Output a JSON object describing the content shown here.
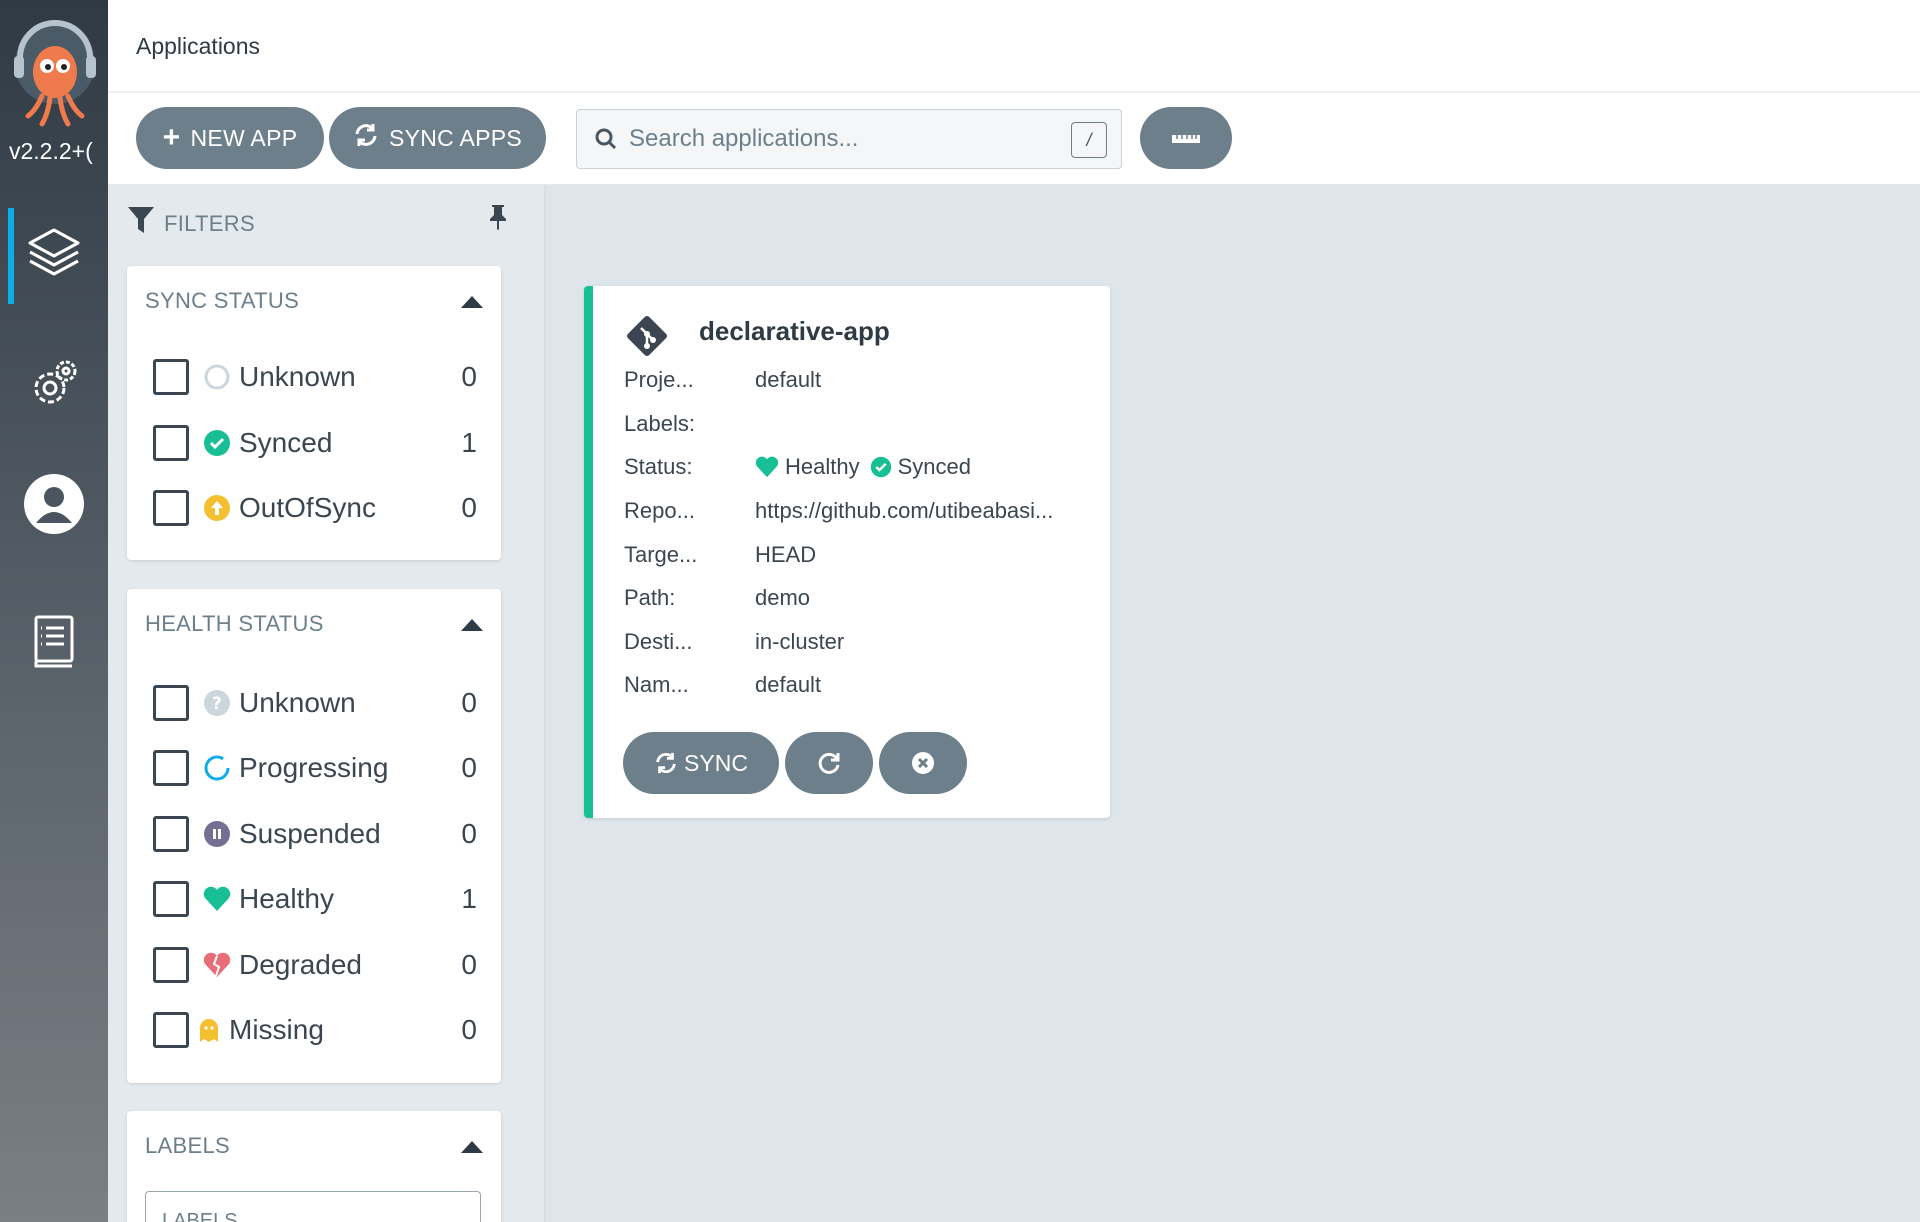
{
  "nav": {
    "version": "v2.2.2+(",
    "items": [
      {
        "name": "applications",
        "icon": "layers-icon"
      },
      {
        "name": "settings",
        "icon": "gears-icon"
      },
      {
        "name": "user-info",
        "icon": "user-icon"
      },
      {
        "name": "docs",
        "icon": "book-icon"
      }
    ]
  },
  "header": {
    "title": "Applications"
  },
  "toolbar": {
    "new_app_label": "NEW APP",
    "sync_apps_label": "SYNC APPS",
    "search_placeholder": "Search applications...",
    "search_shortcut": "/"
  },
  "filters": {
    "title": "FILTERS",
    "sync_status": {
      "title": "SYNC STATUS",
      "items": [
        {
          "label": "Unknown",
          "count": "0"
        },
        {
          "label": "Synced",
          "count": "1"
        },
        {
          "label": "OutOfSync",
          "count": "0"
        }
      ]
    },
    "health_status": {
      "title": "HEALTH STATUS",
      "items": [
        {
          "label": "Unknown",
          "count": "0"
        },
        {
          "label": "Progressing",
          "count": "0"
        },
        {
          "label": "Suspended",
          "count": "0"
        },
        {
          "label": "Healthy",
          "count": "1"
        },
        {
          "label": "Degraded",
          "count": "0"
        },
        {
          "label": "Missing",
          "count": "0"
        }
      ]
    },
    "labels": {
      "title": "LABELS",
      "placeholder": "LABELS"
    }
  },
  "app_card": {
    "name": "declarative-app",
    "rows": [
      {
        "key": "Proje...",
        "value": "default"
      },
      {
        "key": "Labels:",
        "value": ""
      },
      {
        "key": "Status:",
        "health": "Healthy",
        "sync": "Synced"
      },
      {
        "key": "Repo...",
        "value": "https://github.com/utibeabasi..."
      },
      {
        "key": "Targe...",
        "value": "HEAD"
      },
      {
        "key": "Path:",
        "value": "demo"
      },
      {
        "key": "Desti...",
        "value": "in-cluster"
      },
      {
        "key": "Nam...",
        "value": "default"
      }
    ],
    "sync_label": "SYNC"
  },
  "colors": {
    "accent": "#0dadea",
    "synced": "#18be94",
    "out_of_sync": "#f4c030",
    "degraded": "#e96d76",
    "suspended": "#766f94",
    "button": "#6d7f8b"
  }
}
